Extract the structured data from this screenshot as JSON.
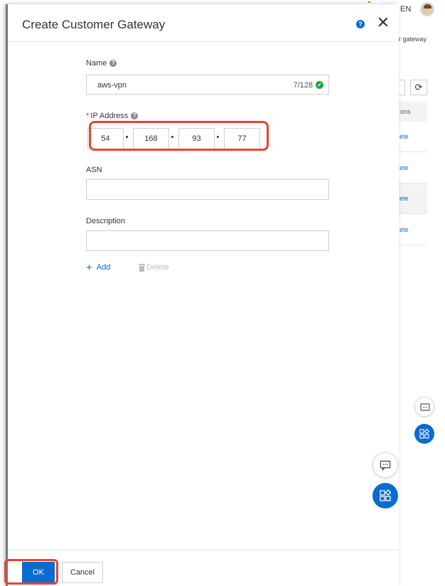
{
  "header": {
    "language": "EN"
  },
  "background": {
    "breadcrumb_fragment": "r gateway",
    "table_header_fragment": "ons",
    "row_actions": [
      "ete",
      "ete",
      "ete",
      "ete"
    ]
  },
  "dialog": {
    "title": "Create Customer Gateway",
    "help_symbol": "?",
    "close_symbol": "✕",
    "form": {
      "name": {
        "label": "Name",
        "value": "aws-vpn",
        "counter": "7/128"
      },
      "ip_address": {
        "label": "IP Address",
        "required_mark": "*",
        "octets": [
          "54",
          "168",
          "93",
          "77"
        ]
      },
      "asn": {
        "label": "ASN",
        "value": ""
      },
      "description": {
        "label": "Description",
        "value": ""
      },
      "add_label": "Add",
      "delete_label": "Delete"
    },
    "footer": {
      "ok_label": "OK",
      "cancel_label": "Cancel"
    }
  },
  "colors": {
    "primary": "#0a6bd1",
    "highlight": "#e8432e",
    "success": "#1aa84a",
    "required": "#e62e2e"
  }
}
